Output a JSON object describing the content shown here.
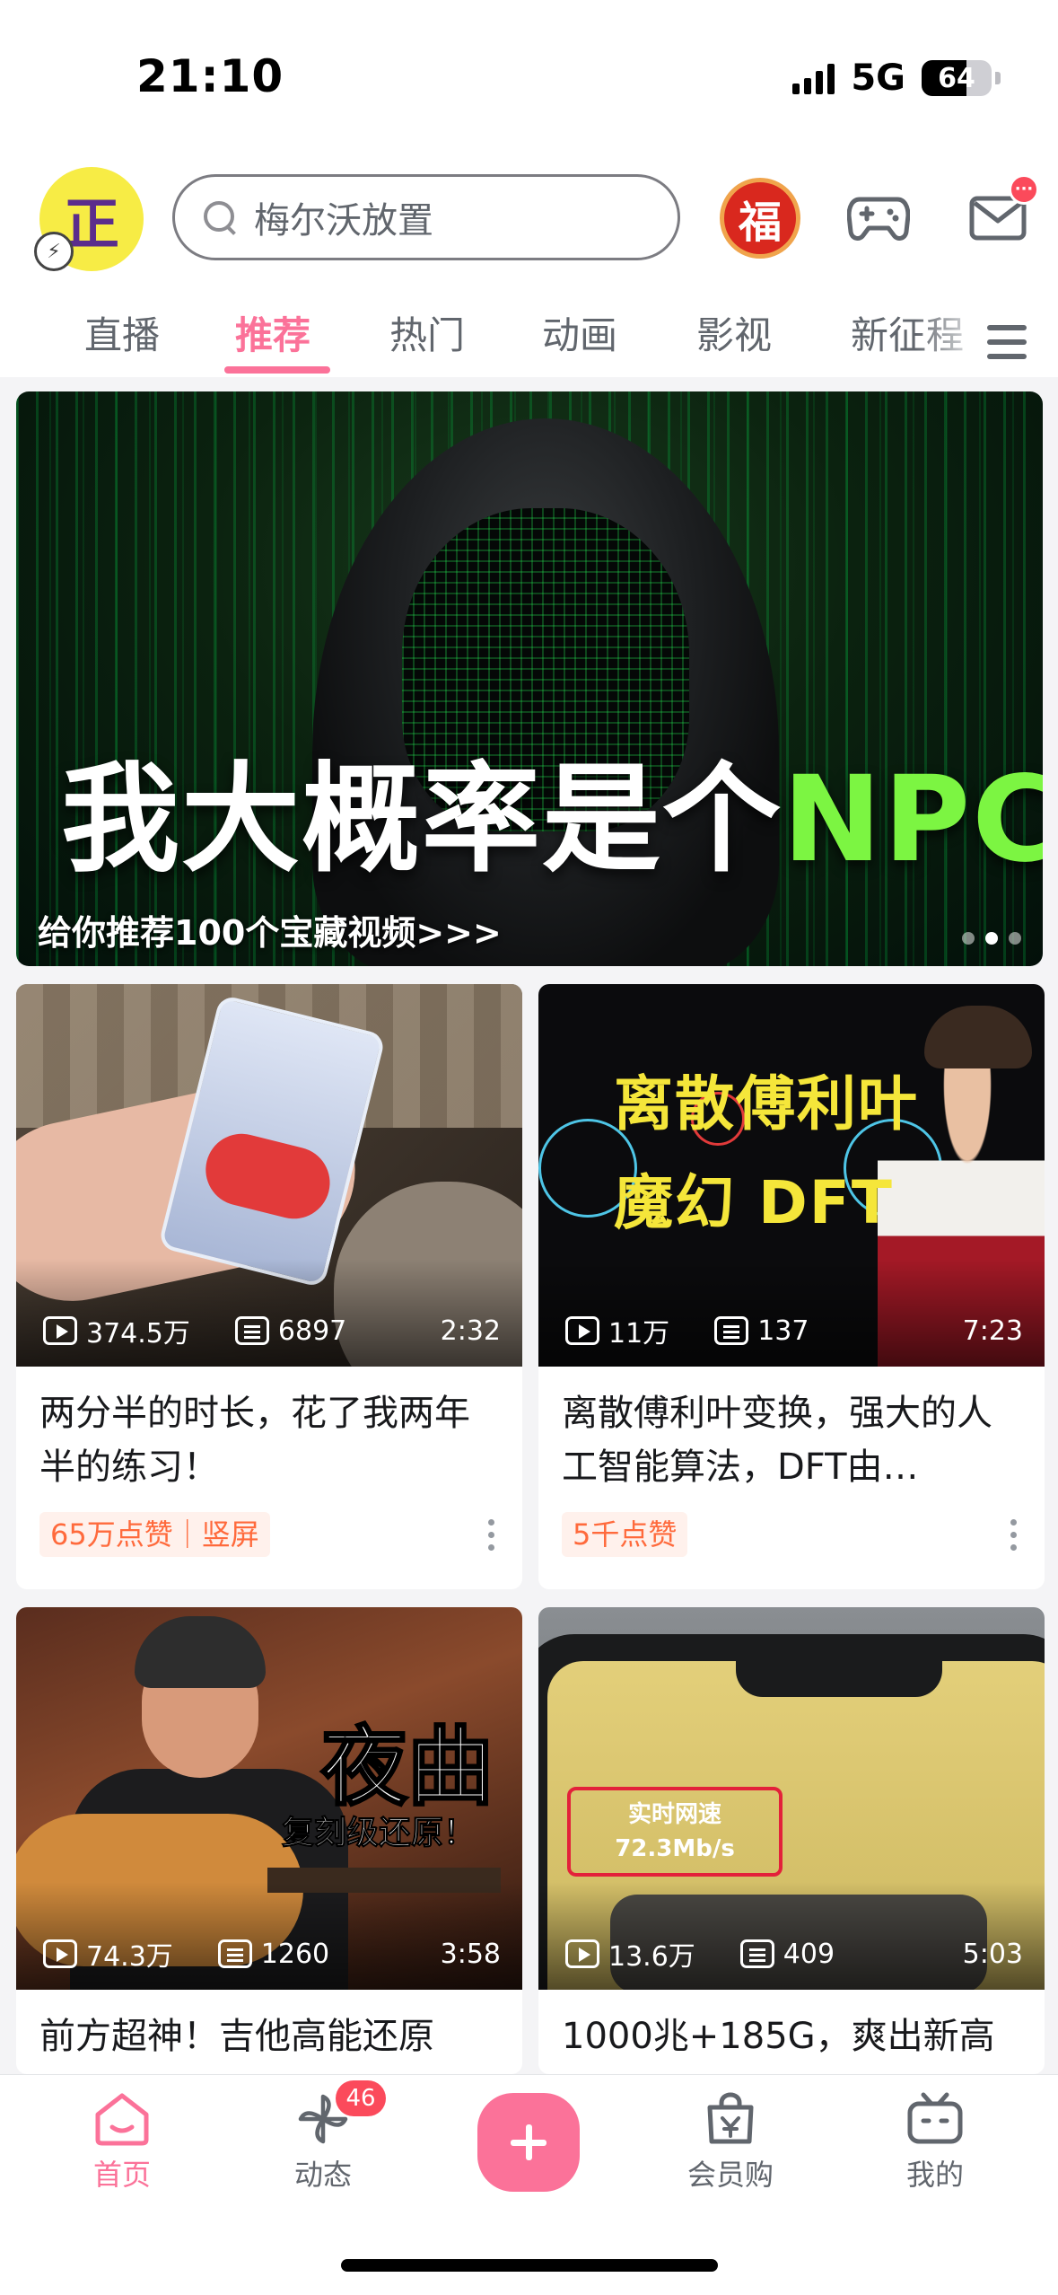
{
  "status_bar": {
    "time": "21:10",
    "network": "5G",
    "battery": "64",
    "battery_level": 0.64
  },
  "header": {
    "avatar_char": "正",
    "search_placeholder": "梅尔沃放置",
    "fu_char": "福"
  },
  "tabs": [
    {
      "label": "直播",
      "active": false
    },
    {
      "label": "推荐",
      "active": true
    },
    {
      "label": "热门",
      "active": false
    },
    {
      "label": "动画",
      "active": false
    },
    {
      "label": "影视",
      "active": false
    },
    {
      "label": "新征程",
      "active": false
    }
  ],
  "banner": {
    "title_main": "我大概率是个",
    "title_accent": "NPC",
    "caption": "给你推荐100个宝藏视频>>>",
    "dot_count": 3,
    "active_dot": 1
  },
  "videos": [
    {
      "views": "374.5万",
      "danmaku": "6897",
      "duration": "2:32",
      "title": "两分半的时长，花了我两年半的练习！",
      "tag": "65万点赞｜竖屏"
    },
    {
      "views": "11万",
      "danmaku": "137",
      "duration": "7:23",
      "title": "离散傅利叶变换，强大的人工智能算法，DFT由…",
      "tag": "5千点赞",
      "thumb_line1": "离散傅利叶",
      "thumb_line2": "魔幻 DFT"
    },
    {
      "views": "74.3万",
      "danmaku": "1260",
      "duration": "3:58",
      "title": "前方超神！吉他高能还原",
      "thumb_big": "夜曲",
      "thumb_small": "复刻级还原！"
    },
    {
      "views": "13.6万",
      "danmaku": "409",
      "duration": "5:03",
      "title": "1000兆+185G，爽出新高",
      "thumb_speed_label": "实时网速",
      "thumb_speed_value": "72.3Mb/s"
    }
  ],
  "bottom_nav": {
    "home": "首页",
    "dynamic": "动态",
    "dynamic_badge": "46",
    "vip": "会员购",
    "mine": "我的"
  },
  "colors": {
    "accent": "#fb7299",
    "badge": "#fb4a5b",
    "tag_text": "#ff6a3c"
  }
}
